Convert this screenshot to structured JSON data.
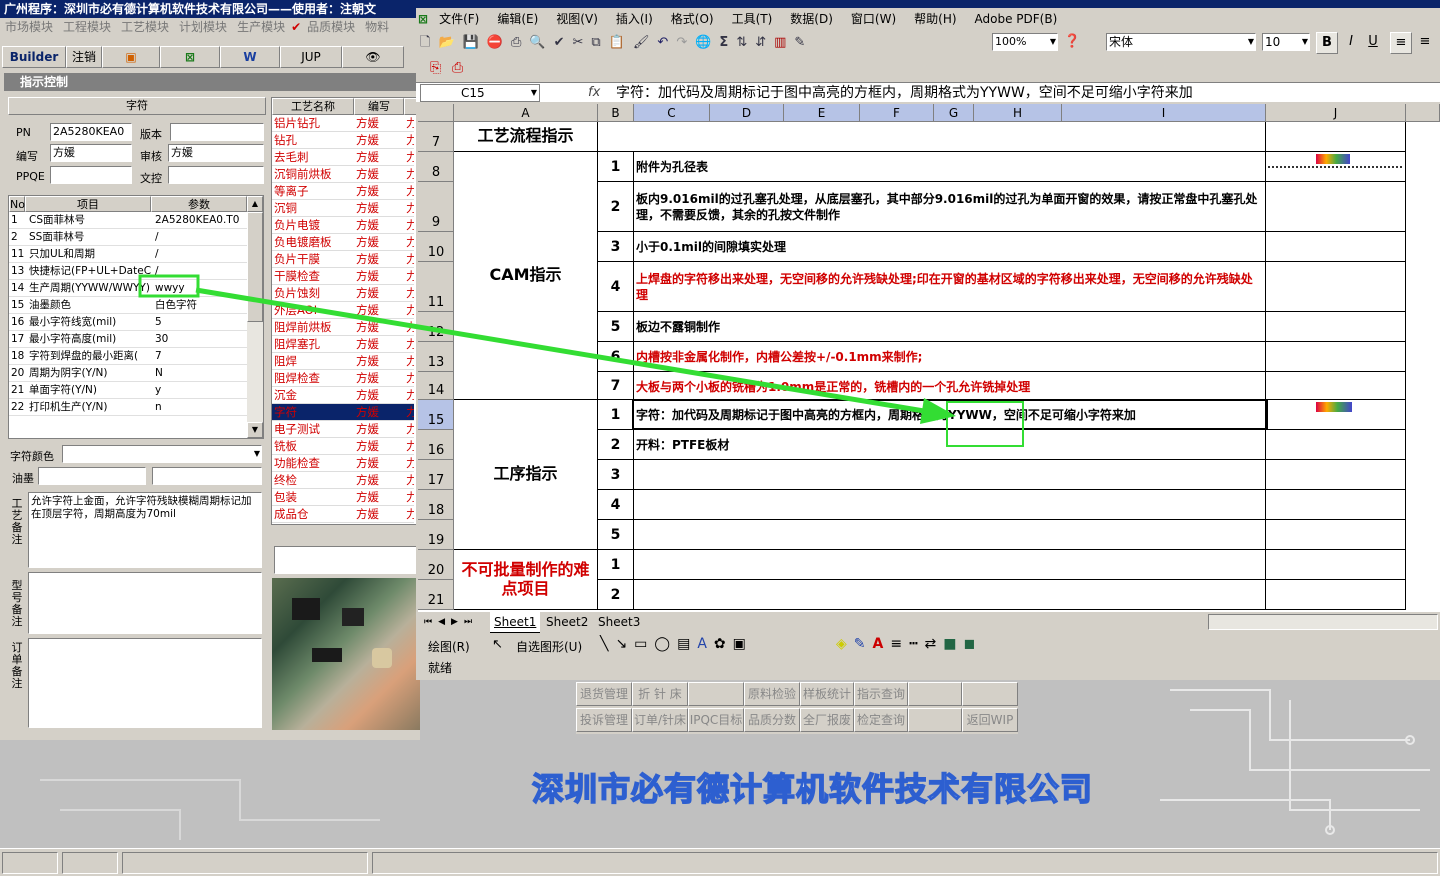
{
  "left_app": {
    "title": "广州程序：深圳市必有德计算机软件技术有限公司——使用者：注朝文",
    "menu": [
      "市场模块",
      "工程模块",
      "工艺模块",
      "计划模块",
      "生产模块",
      "品质模块",
      "物料"
    ],
    "toolbar": {
      "builder": "Builder",
      "logout": "注销",
      "jup": "JUP"
    },
    "section_title": "指示控制",
    "char_header": "字符",
    "pn_label": "PN",
    "pn_value": "2A5280KEA0",
    "version_label": "版本",
    "version_value": "",
    "editor_label": "编写",
    "editor_value": "方媛",
    "reviewer_label": "审核",
    "reviewer_value": "方媛",
    "ppqe_label": "PPQE",
    "ppqe_value": "",
    "doc_label": "文控",
    "doc_value": "",
    "param_headers": [
      "No",
      "项目",
      "参数"
    ],
    "params": [
      {
        "no": "1",
        "item": "CS面菲林号",
        "value": "2A5280KEA0.T0"
      },
      {
        "no": "2",
        "item": "SS面菲林号",
        "value": "/"
      },
      {
        "no": "11",
        "item": "只加UL和周期",
        "value": "/"
      },
      {
        "no": "13",
        "item": "快捷标记(FP+UL+DateCo",
        "value": "/"
      },
      {
        "no": "14",
        "item": "生产周期(YYWW/WWYY)",
        "value": "wwyy"
      },
      {
        "no": "15",
        "item": "油墨颜色",
        "value": "白色字符"
      },
      {
        "no": "16",
        "item": "最小字符线宽(mil)",
        "value": "5"
      },
      {
        "no": "17",
        "item": "最小字符高度(mil)",
        "value": "30"
      },
      {
        "no": "18",
        "item": "字符到焊盘的最小距离(",
        "value": "7"
      },
      {
        "no": "20",
        "item": "周期为阴字(Y/N)",
        "value": "N"
      },
      {
        "no": "21",
        "item": "单面字符(Y/N)",
        "value": "y"
      },
      {
        "no": "22",
        "item": "打印机生产(Y/N)",
        "value": "n"
      }
    ],
    "char_color_label": "字符颜色",
    "ink_label": "油墨",
    "craft_note_label": "工艺备注",
    "craft_note_text": "允许字符上金面，允许字符残缺模糊周期标记加在顶层字符，周期高度为70mil",
    "model_note_label": "型号备注",
    "order_note_label": "订单备注",
    "process_headers": [
      "工艺名称",
      "编写"
    ],
    "processes": [
      {
        "name": "铝片钻孔",
        "author": "方媛"
      },
      {
        "name": "钻孔",
        "author": "方媛"
      },
      {
        "name": "去毛刺",
        "author": "方媛"
      },
      {
        "name": "沉铜前烘板",
        "author": "方媛"
      },
      {
        "name": "等离子",
        "author": "方媛"
      },
      {
        "name": "沉铜",
        "author": "方媛"
      },
      {
        "name": "负片电镀",
        "author": "方媛"
      },
      {
        "name": "负电镀磨板",
        "author": "方媛"
      },
      {
        "name": "负片干膜",
        "author": "方媛"
      },
      {
        "name": "干膜检查",
        "author": "方媛"
      },
      {
        "name": "负片蚀刻",
        "author": "方媛"
      },
      {
        "name": "外层AOI",
        "author": "方媛"
      },
      {
        "name": "阻焊前烘板",
        "author": "方媛"
      },
      {
        "name": "阻焊塞孔",
        "author": "方媛"
      },
      {
        "name": "阻焊",
        "author": "方媛"
      },
      {
        "name": "阻焊检查",
        "author": "方媛"
      },
      {
        "name": "沉金",
        "author": "方媛"
      },
      {
        "name": "字符",
        "author": "方媛"
      },
      {
        "name": "电子测试",
        "author": "方媛"
      },
      {
        "name": "铣板",
        "author": "方媛"
      },
      {
        "name": "功能检查",
        "author": "方媛"
      },
      {
        "name": "终检",
        "author": "方媛"
      },
      {
        "name": "包装",
        "author": "方媛"
      },
      {
        "name": "成品仓",
        "author": "方媛"
      }
    ],
    "selected_process": "字符"
  },
  "excel": {
    "menu": [
      "文件(F)",
      "编辑(E)",
      "视图(V)",
      "插入(I)",
      "格式(O)",
      "工具(T)",
      "数据(D)",
      "窗口(W)",
      "帮助(H)",
      "Adobe PDF(B)"
    ],
    "zoom": "100%",
    "font": "宋体",
    "font_size": "10",
    "name_box": "C15",
    "formula": "字符：加代码及周期标记于图中高亮的方框内，周期格式为YYWW，空间不足可缩小字符来加",
    "columns": [
      "A",
      "B",
      "C",
      "D",
      "E",
      "F",
      "G",
      "H",
      "I",
      "J"
    ],
    "rows": [
      "7",
      "8",
      "9",
      "10",
      "11",
      "12",
      "13",
      "14",
      "15",
      "16",
      "17",
      "18",
      "19",
      "20",
      "21"
    ],
    "header_cell": "工艺流程指示",
    "cam_label": "CAM指示",
    "cam_items": [
      {
        "n": "1",
        "text": "附件为孔径表"
      },
      {
        "n": "2",
        "text": "板内9.016mil的过孔塞孔处理，从底层塞孔，其中部分9.016mil的过孔为单面开窗的效果，请按正常盘中孔塞孔处理，不需要反馈，其余的孔按文件制作"
      },
      {
        "n": "3",
        "text": "小于0.1mil的间隙填实处理"
      },
      {
        "n": "4",
        "text": "上焊盘的字符移出来处理，无空间移的允许残缺处理;印在开窗的基材区域的字符移出来处理，无空间移的允许残缺处理"
      },
      {
        "n": "5",
        "text": "板边不露铜制作"
      },
      {
        "n": "6",
        "text": "内槽按非金属化制作，内槽公差按+/-0.1mm来制作;"
      },
      {
        "n": "7",
        "text": "大板与两个小板的铣槽为1.0mm是正常的，铣槽内的一个孔允许铣掉处理"
      }
    ],
    "proc_label": "工序指示",
    "proc_items": [
      {
        "n": "1",
        "text": "字符：加代码及周期标记于图中高亮的方框内，周期格式为YYWW，空间不足可缩小字符来加"
      },
      {
        "n": "2",
        "text": "开料：PTFE板材"
      },
      {
        "n": "3",
        "text": ""
      },
      {
        "n": "4",
        "text": ""
      },
      {
        "n": "5",
        "text": ""
      }
    ],
    "hard_label": "不可批量制作的难点项目",
    "hard_items": [
      {
        "n": "1",
        "text": ""
      },
      {
        "n": "2",
        "text": ""
      }
    ],
    "sheets": [
      "Sheet1",
      "Sheet2",
      "Sheet3"
    ],
    "draw_label": "绘图(R)",
    "autoshape_label": "自选图形(U)",
    "status": "就绪"
  },
  "bottom_buttons": [
    [
      "退货管理",
      "折 针 床",
      "",
      "原料检验",
      "样板统计",
      "指示查询",
      "",
      ""
    ],
    [
      "投诉管理",
      "订单/针床",
      "IPQC目标",
      "品质分数",
      "全厂报废",
      "检定查询",
      "",
      "返回WIP"
    ]
  ],
  "company": "深圳市必有德计算机软件技术有限公司",
  "colors": {
    "highlight_green": "#33dd33",
    "red_text": "#d00000",
    "title_blue": "#0a246a"
  }
}
